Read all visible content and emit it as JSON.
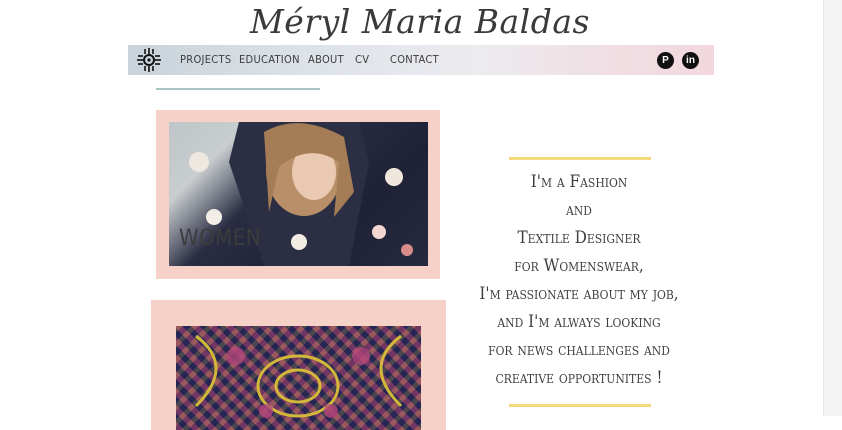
{
  "header": {
    "site_title": "Méryl Maria Baldas"
  },
  "nav": {
    "logo_icon": "sun-symbol-icon",
    "items": [
      {
        "label": "Projects"
      },
      {
        "label": "Education"
      },
      {
        "label": "About"
      },
      {
        "label": "CV"
      },
      {
        "label": "Contact"
      }
    ],
    "social": [
      {
        "icon": "pinterest-icon",
        "glyph": "P"
      },
      {
        "icon": "linkedin-icon",
        "glyph": "in"
      }
    ]
  },
  "cards": {
    "women": {
      "label": "WOMEN"
    }
  },
  "bio": {
    "lines": [
      "I'm a Fashion",
      "and",
      "Textile Designer",
      "for Womenswear,",
      "I'm passionate about my job,",
      "and I'm always looking",
      "for news challenges and",
      "creative opportunites !"
    ]
  },
  "colors": {
    "card_pink": "#f6d1c8",
    "accent_yellow": "#f3d97a",
    "accent_teal": "#a9c4c5"
  }
}
